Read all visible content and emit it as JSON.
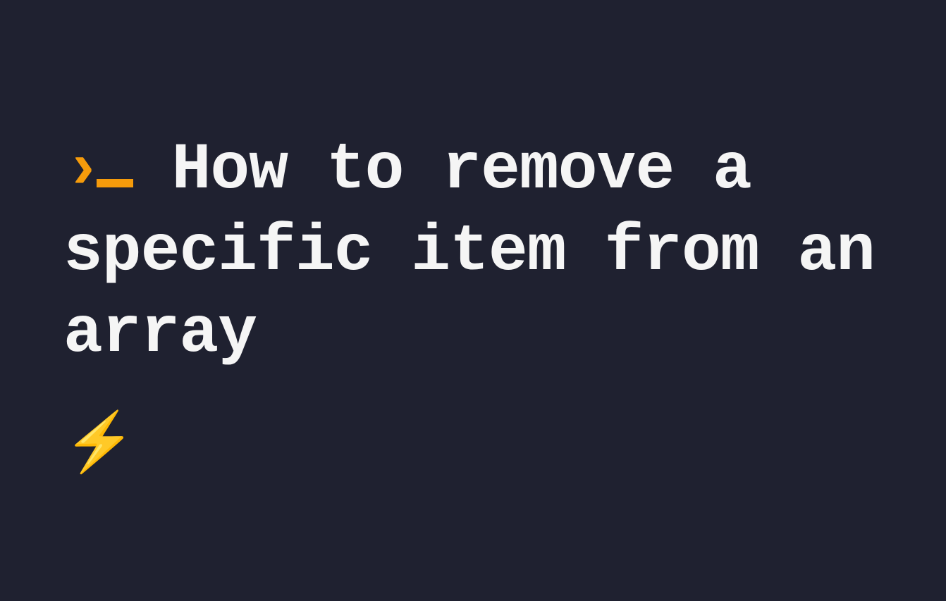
{
  "title": {
    "text": "How to remove a specific item from an array"
  },
  "decorations": {
    "lightning_emoji": "⚡"
  }
}
